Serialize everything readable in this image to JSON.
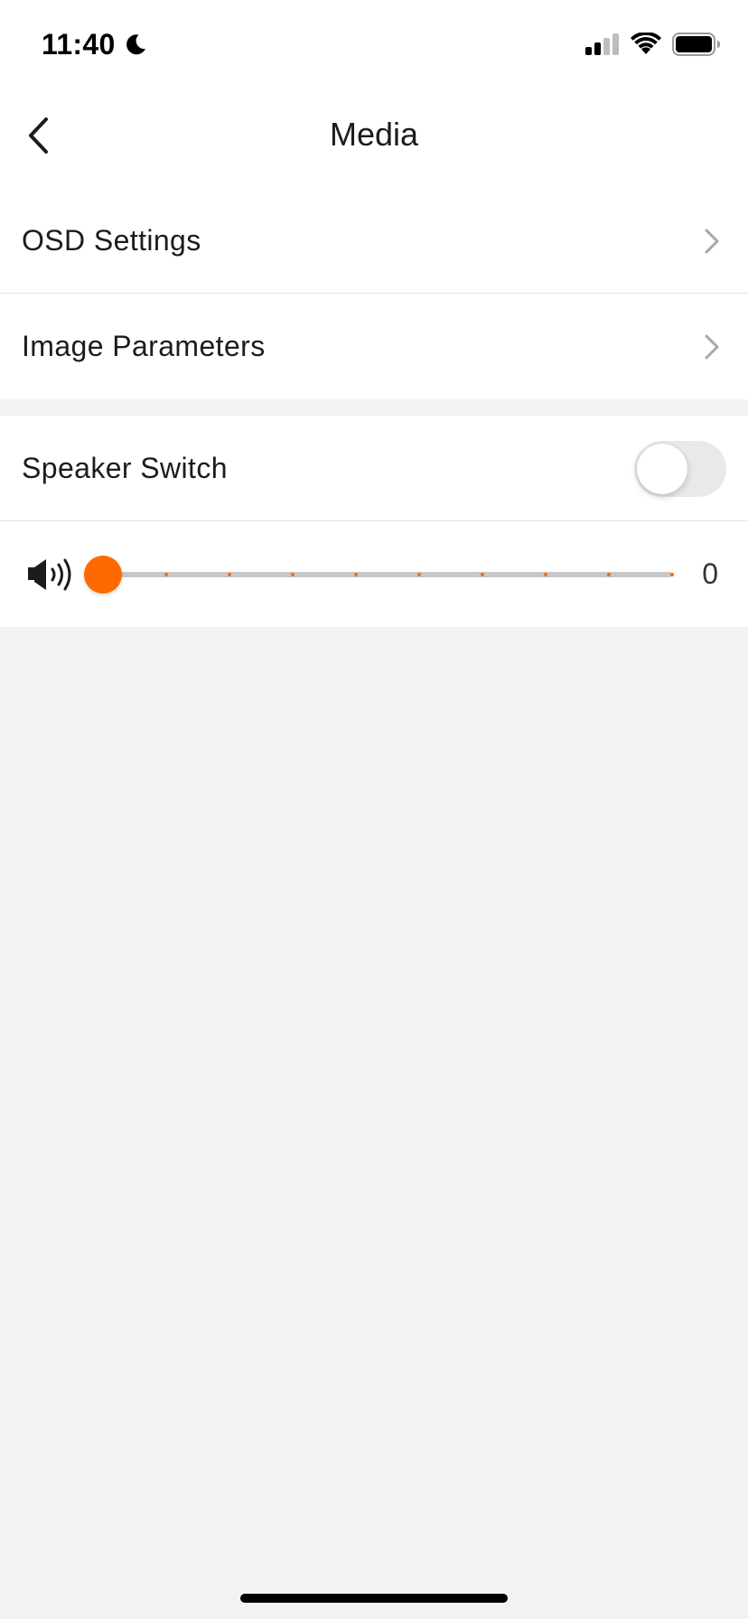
{
  "status_bar": {
    "time": "11:40",
    "moon_icon": "moon-icon",
    "signal_icon": "cellular-signal-icon",
    "wifi_icon": "wifi-icon",
    "battery_icon": "battery-icon"
  },
  "header": {
    "back_icon": "chevron-left-icon",
    "title": "Media"
  },
  "menu": {
    "items": [
      {
        "label": "OSD Settings",
        "icon": "chevron-right-icon"
      },
      {
        "label": "Image Parameters",
        "icon": "chevron-right-icon"
      }
    ]
  },
  "speaker": {
    "switch_label": "Speaker Switch",
    "switch_on": false
  },
  "volume": {
    "icon": "speaker-volume-icon",
    "value": "0",
    "level": 0,
    "min": 0,
    "max": 9,
    "accent_color": "#ff6a00",
    "track_color": "#c7c7c7"
  },
  "colors": {
    "background": "#f2f2f2",
    "surface": "#ffffff",
    "accent": "#ff6a00",
    "toggle_off": "#e9e9ea"
  }
}
